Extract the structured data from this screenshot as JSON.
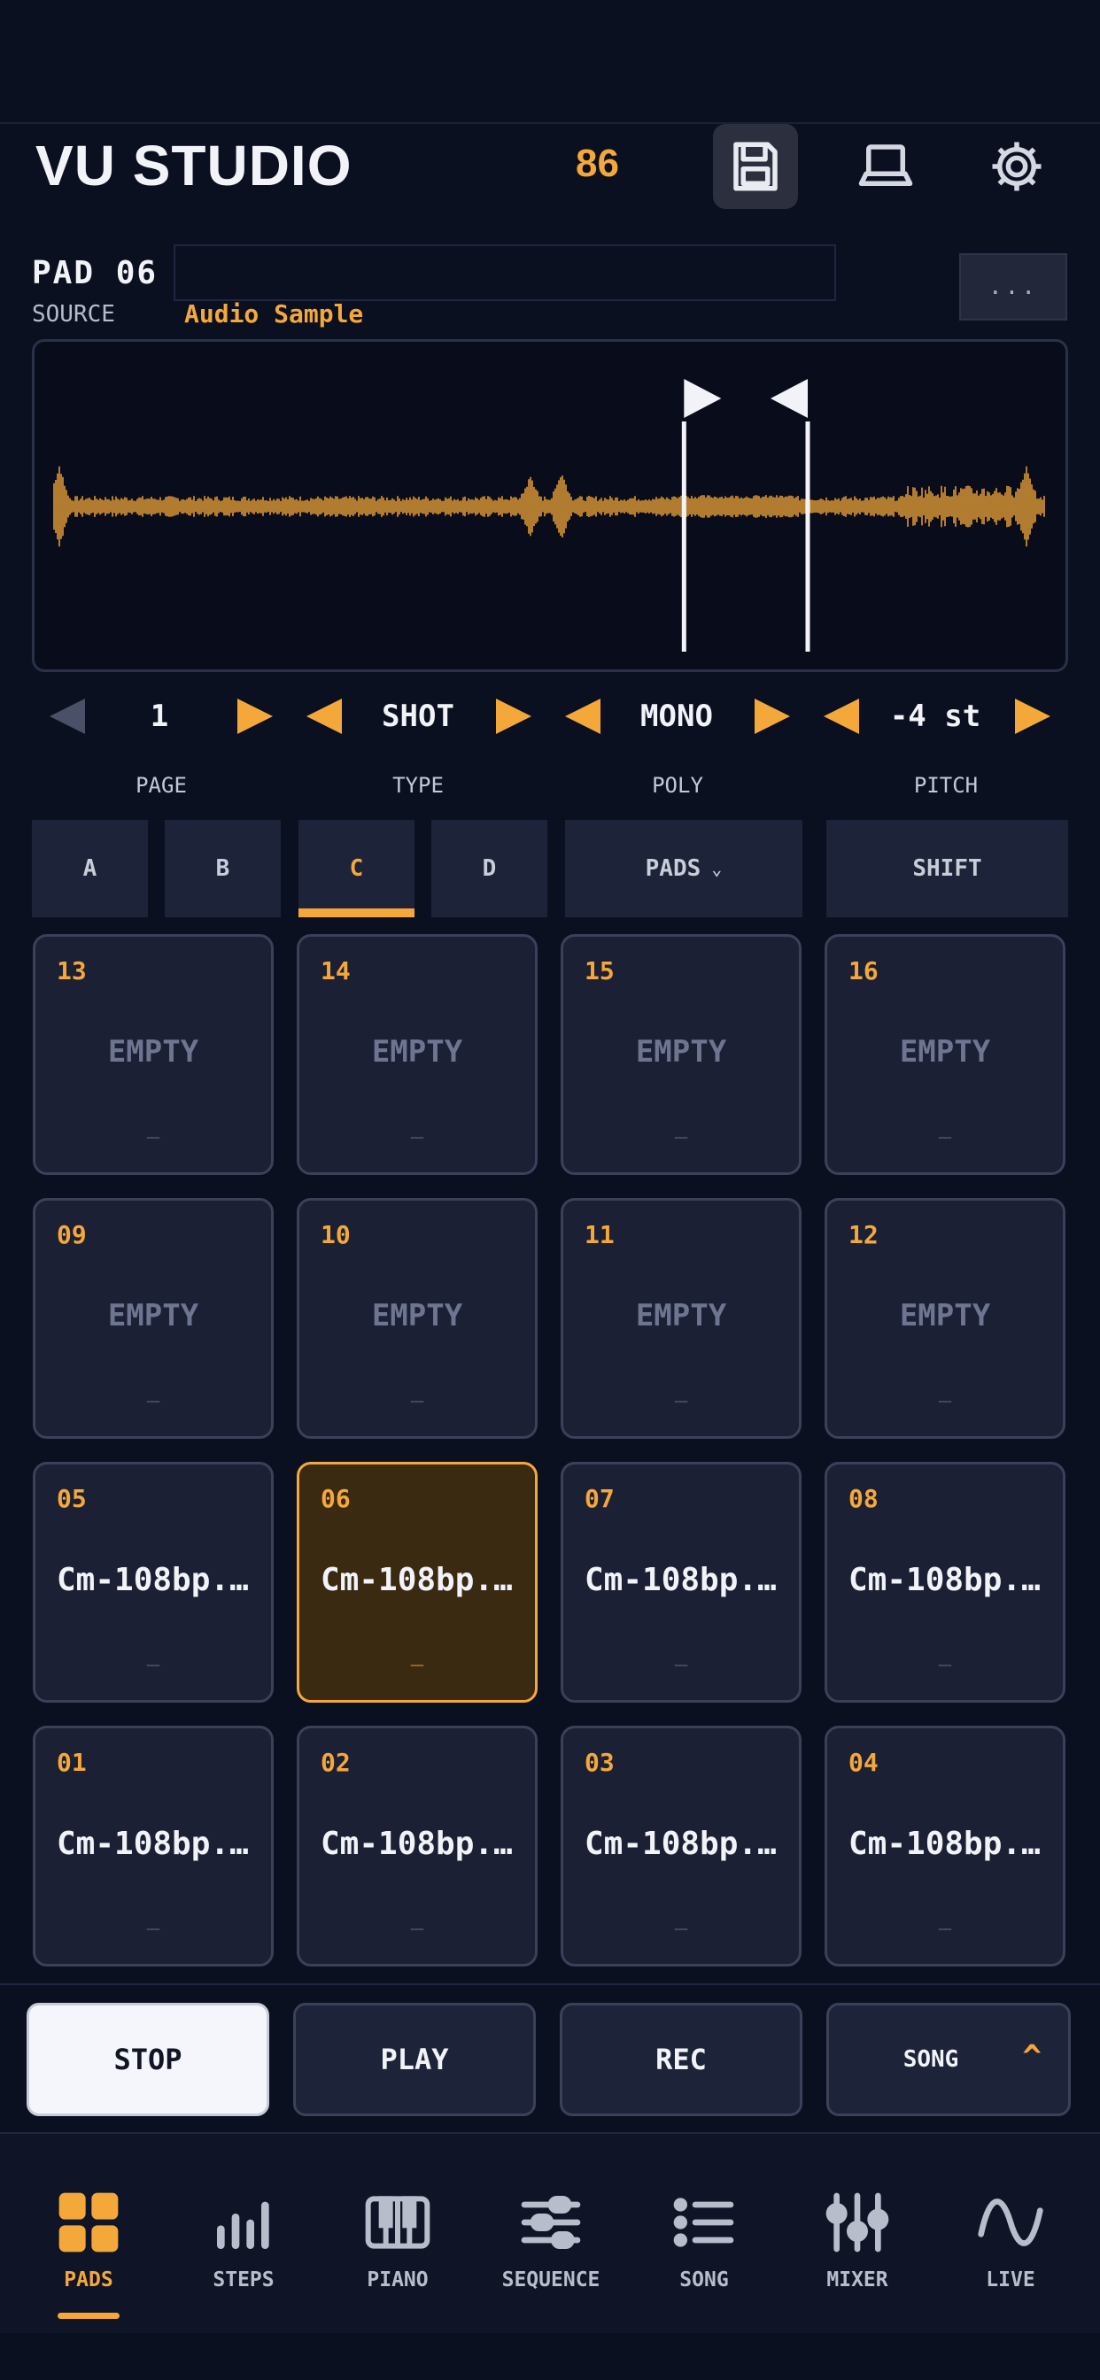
{
  "app": {
    "title": "VU STUDIO",
    "bpm": "86"
  },
  "pad_editor": {
    "pad_label": "PAD 06",
    "pad_name": "",
    "source_label": "SOURCE",
    "source_value": "Audio Sample",
    "more_label": "...",
    "start_marker": 0.63,
    "end_marker": 0.75
  },
  "params": [
    {
      "value": "1",
      "label": "PAGE"
    },
    {
      "value": "SHOT",
      "label": "TYPE"
    },
    {
      "value": "MONO",
      "label": "POLY"
    },
    {
      "value": "-4 st",
      "label": "PITCH"
    }
  ],
  "bank_tabs": [
    {
      "label": "A"
    },
    {
      "label": "B"
    },
    {
      "label": "C",
      "active": true
    },
    {
      "label": "D"
    }
  ],
  "pads_dropdown": "PADS",
  "shift_label": "SHIFT",
  "pads": [
    {
      "num": "13",
      "name": "EMPTY",
      "sub": "_"
    },
    {
      "num": "14",
      "name": "EMPTY",
      "sub": "_"
    },
    {
      "num": "15",
      "name": "EMPTY",
      "sub": "_"
    },
    {
      "num": "16",
      "name": "EMPTY",
      "sub": "_"
    },
    {
      "num": "09",
      "name": "EMPTY",
      "sub": "_"
    },
    {
      "num": "10",
      "name": "EMPTY",
      "sub": "_"
    },
    {
      "num": "11",
      "name": "EMPTY",
      "sub": "_"
    },
    {
      "num": "12",
      "name": "EMPTY",
      "sub": "_"
    },
    {
      "num": "05",
      "name": "Cm-108bp...",
      "sub": "_"
    },
    {
      "num": "06",
      "name": "Cm-108bp...",
      "sub": "_",
      "selected": true
    },
    {
      "num": "07",
      "name": "Cm-108bp...",
      "sub": "_"
    },
    {
      "num": "08",
      "name": "Cm-108bp...",
      "sub": "_"
    },
    {
      "num": "01",
      "name": "Cm-108bp...",
      "sub": "_"
    },
    {
      "num": "02",
      "name": "Cm-108bp...",
      "sub": "_"
    },
    {
      "num": "03",
      "name": "Cm-108bp...",
      "sub": "_"
    },
    {
      "num": "04",
      "name": "Cm-108bp...",
      "sub": "_"
    }
  ],
  "transport": {
    "stop": "STOP",
    "play": "PLAY",
    "rec": "REC",
    "song": "SONG",
    "caret": "^"
  },
  "nav": [
    {
      "label": "PADS",
      "icon": "pads-grid-icon",
      "active": true
    },
    {
      "label": "STEPS",
      "icon": "bars-icon"
    },
    {
      "label": "PIANO",
      "icon": "piano-icon"
    },
    {
      "label": "SEQUENCE",
      "icon": "sliders-icon"
    },
    {
      "label": "SONG",
      "icon": "list-icon"
    },
    {
      "label": "MIXER",
      "icon": "mixer-icon"
    },
    {
      "label": "LIVE",
      "icon": "wave-icon"
    }
  ],
  "colors": {
    "accent": "#f5a83a",
    "background": "#0b1021",
    "pad": "#1b2035",
    "selected_pad": "#3a2a12"
  }
}
